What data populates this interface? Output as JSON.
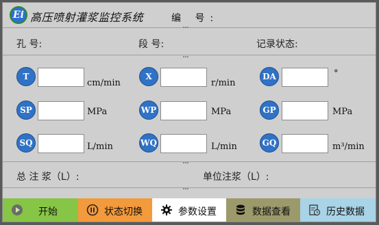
{
  "header": {
    "logo_text": "Ei",
    "title": "高压喷射灌浆监控系统",
    "number_label": "编 号:"
  },
  "info_row": {
    "hole_label": "孔   号:",
    "segment_label": "段   号:",
    "record_status_label": "记录状态:"
  },
  "params": [
    {
      "code": "T",
      "unit": "cm/min",
      "value": ""
    },
    {
      "code": "X",
      "unit": "r/min",
      "value": ""
    },
    {
      "code": "DA",
      "unit": "°",
      "value": ""
    },
    {
      "code": "SP",
      "unit": "MPa",
      "value": ""
    },
    {
      "code": "WP",
      "unit": "MPa",
      "value": ""
    },
    {
      "code": "GP",
      "unit": "MPa",
      "value": ""
    },
    {
      "code": "SQ",
      "unit": "L/min",
      "value": ""
    },
    {
      "code": "WQ",
      "unit": "L/min",
      "value": ""
    },
    {
      "code": "GQ",
      "unit": "m³/min",
      "value": ""
    }
  ],
  "totals": {
    "total_grout_label": "总 注 浆（L）:",
    "unit_grout_label": "单位注浆（L）:"
  },
  "toolbar": {
    "start_label": "开始",
    "toggle_label": "状态切换",
    "settings_label": "参数设置",
    "data_view_label": "数据查看",
    "history_label": "历史数据"
  },
  "colors": {
    "start_bg": "#86c545",
    "toggle_bg": "#f39a3c",
    "settings_bg": "#ffffff",
    "data_view_bg": "#9c9a6a",
    "history_bg": "#a9d3e6",
    "badge_blue": "#2f72c6"
  }
}
